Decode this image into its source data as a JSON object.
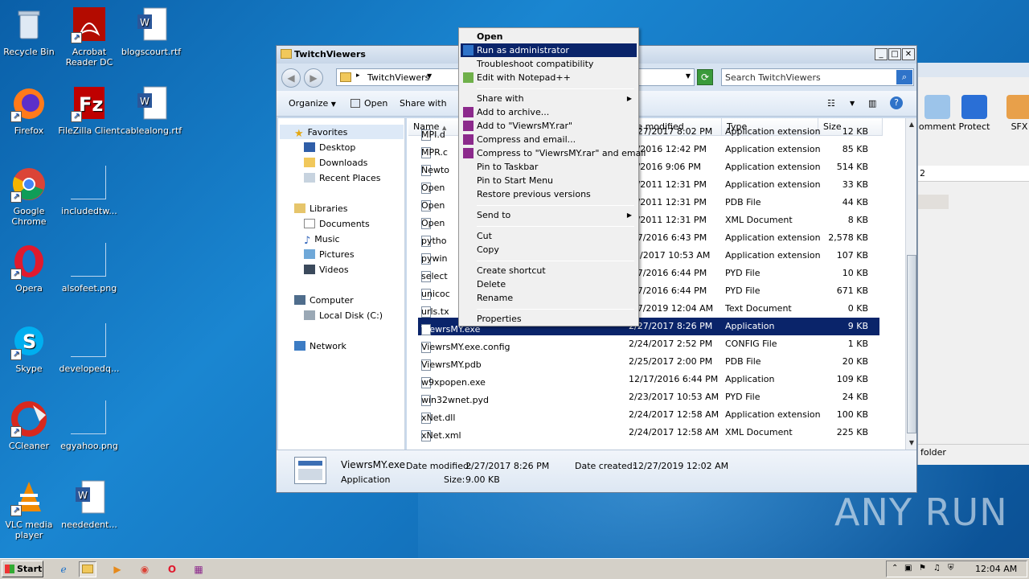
{
  "desktop": {
    "icons": [
      {
        "label": "Recycle Bin"
      },
      {
        "label": "Acrobat Reader DC"
      },
      {
        "label": "blogscourt.rtf"
      },
      {
        "label": "Firefox"
      },
      {
        "label": "FileZilla Client"
      },
      {
        "label": "cablealong.rtf"
      },
      {
        "label": "Google Chrome"
      },
      {
        "label": "includedtw..."
      },
      {
        "label": "Opera"
      },
      {
        "label": "alsofeet.png"
      },
      {
        "label": "Skype"
      },
      {
        "label": "developedq..."
      },
      {
        "label": "CCleaner"
      },
      {
        "label": "egyahoo.png"
      },
      {
        "label": "VLC media player"
      },
      {
        "label": "neededent..."
      }
    ]
  },
  "explorer": {
    "title": "TwitchViewers",
    "address": "TwitchViewers",
    "search_placeholder": "Search TwitchViewers",
    "toolbar": {
      "organize": "Organize",
      "open": "Open",
      "share_with": "Share with"
    },
    "nav": {
      "favorites": "Favorites",
      "desktop": "Desktop",
      "downloads": "Downloads",
      "recent": "Recent Places",
      "libraries": "Libraries",
      "documents": "Documents",
      "music": "Music",
      "pictures": "Pictures",
      "videos": "Videos",
      "computer": "Computer",
      "localdisk": "Local Disk (C:)",
      "network": "Network"
    },
    "columns": {
      "name": "Name",
      "date": "te modified",
      "type": "Type",
      "size": "Size"
    },
    "files": [
      {
        "name": "MPI.d",
        "date": "2/27/2017 8:02 PM",
        "type": "Application extension",
        "size": "12 KB"
      },
      {
        "name": "MPR.c",
        "date": ".6/2016 12:42 PM",
        "type": "Application extension",
        "size": "85 KB"
      },
      {
        "name": "Newto",
        "date": ".3/2016 9:06 PM",
        "type": "Application extension",
        "size": "514 KB"
      },
      {
        "name": "Open",
        "date": ".1/2011 12:31 PM",
        "type": "Application extension",
        "size": "33 KB"
      },
      {
        "name": "Open",
        "date": ".1/2011 12:31 PM",
        "type": "PDB File",
        "size": "44 KB"
      },
      {
        "name": "Open",
        "date": ".1/2011 12:31 PM",
        "type": "XML Document",
        "size": "8 KB"
      },
      {
        "name": "pytho",
        "date": "/17/2016 6:43 PM",
        "type": "Application extension",
        "size": "2,578 KB"
      },
      {
        "name": "pywin",
        "date": "23/2017 10:53 AM",
        "type": "Application extension",
        "size": "107 KB"
      },
      {
        "name": "select",
        "date": "/17/2016 6:44 PM",
        "type": "PYD File",
        "size": "10 KB"
      },
      {
        "name": "unicoc",
        "date": "/17/2016 6:44 PM",
        "type": "PYD File",
        "size": "671 KB"
      },
      {
        "name": "urls.tx",
        "date": "/27/2019 12:04 AM",
        "type": "Text Document",
        "size": "0 KB"
      },
      {
        "name": "ViewrsMY.exe",
        "date": "2/27/2017 8:26 PM",
        "type": "Application",
        "size": "9 KB"
      },
      {
        "name": "ViewrsMY.exe.config",
        "date": "2/24/2017 2:52 PM",
        "type": "CONFIG File",
        "size": "1 KB"
      },
      {
        "name": "ViewrsMY.pdb",
        "date": "2/25/2017 2:00 PM",
        "type": "PDB File",
        "size": "20 KB"
      },
      {
        "name": "w9xpopen.exe",
        "date": "12/17/2016 6:44 PM",
        "type": "Application",
        "size": "109 KB"
      },
      {
        "name": "win32wnet.pyd",
        "date": "2/23/2017 10:53 AM",
        "type": "PYD File",
        "size": "24 KB"
      },
      {
        "name": "xNet.dll",
        "date": "2/24/2017 12:58 AM",
        "type": "Application extension",
        "size": "100 KB"
      },
      {
        "name": "xNet.xml",
        "date": "2/24/2017 12:58 AM",
        "type": "XML Document",
        "size": "225 KB"
      }
    ],
    "details": {
      "name": "ViewrsMY.exe",
      "date_modified_label": "Date modified:",
      "date_modified": "2/27/2017 8:26 PM",
      "date_created_label": "Date created:",
      "date_created": "12/27/2019 12:02 AM",
      "type": "Application",
      "size_label": "Size:",
      "size": "9.00 KB"
    }
  },
  "context_menu": {
    "items": [
      {
        "label": "Open"
      },
      {
        "label": "Run as administrator"
      },
      {
        "label": "Troubleshoot compatibility"
      },
      {
        "label": "Edit with Notepad++"
      },
      {
        "label": "Share with"
      },
      {
        "label": "Add to archive..."
      },
      {
        "label": "Add to \"ViewrsMY.rar\""
      },
      {
        "label": "Compress and email..."
      },
      {
        "label": "Compress to \"ViewrsMY.rar\" and email"
      },
      {
        "label": "Pin to Taskbar"
      },
      {
        "label": "Pin to Start Menu"
      },
      {
        "label": "Restore previous versions"
      },
      {
        "label": "Send to"
      },
      {
        "label": "Cut"
      },
      {
        "label": "Copy"
      },
      {
        "label": "Create shortcut"
      },
      {
        "label": "Delete"
      },
      {
        "label": "Rename"
      },
      {
        "label": "Properties"
      }
    ]
  },
  "bg_window": {
    "comment": "omment",
    "protect": "Protect",
    "sfx": "SFX",
    "folder": "folder",
    "col2": "2"
  },
  "taskbar": {
    "start": "Start",
    "clock": "12:04 AM"
  },
  "watermark": "ANY RUN"
}
